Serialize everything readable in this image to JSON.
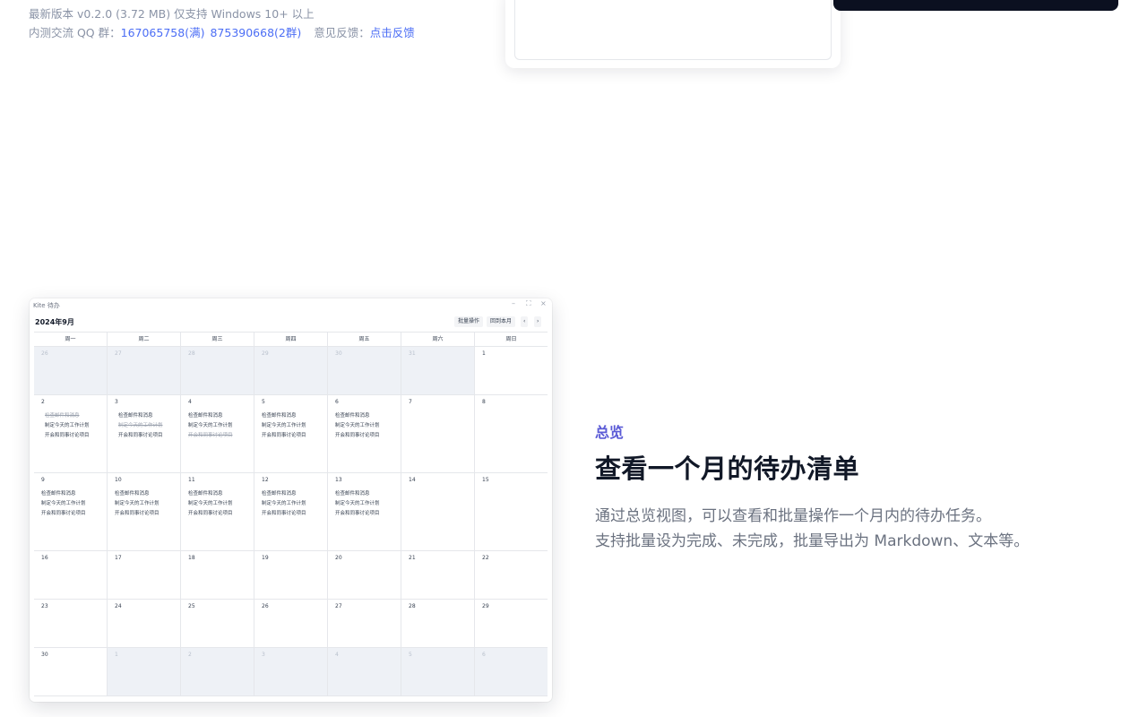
{
  "info": {
    "version_line": "最新版本 v0.2.0 (3.72 MB) 仅支持 Windows 10+ 以上",
    "qq_label": "内测交流 QQ 群：",
    "qq_group1": "167065758(满)",
    "qq_group2": "875390668(2群)",
    "feedback_label": "意见反馈：",
    "feedback_link": "点击反馈"
  },
  "colors": {
    "accent": "#5b5bd6",
    "link": "#4c6ef5",
    "task_red": "#ef4444",
    "task_orange": "#f97316",
    "task_green": "#22c55e",
    "task_blue": "#3b82f6",
    "task_purple": "#8b5cf6",
    "task_gray": "#64748b"
  },
  "window": {
    "title": "Kite 待办",
    "controls": [
      "minimize-icon",
      "maximize-icon",
      "close-icon"
    ],
    "month": "2024年9月",
    "batch_button": "批量操作",
    "today_button": "回到本月",
    "prev_icon": "chevron-left-icon",
    "next_icon": "chevron-right-icon",
    "weekdays": [
      "周一",
      "周二",
      "周三",
      "周四",
      "周五",
      "周六",
      "周日"
    ],
    "weeks": [
      [
        {
          "d": "26",
          "out": true,
          "tasks": []
        },
        {
          "d": "27",
          "out": true,
          "tasks": []
        },
        {
          "d": "28",
          "out": true,
          "tasks": []
        },
        {
          "d": "29",
          "out": true,
          "tasks": []
        },
        {
          "d": "30",
          "out": true,
          "tasks": []
        },
        {
          "d": "31",
          "out": true,
          "tasks": []
        },
        {
          "d": "1",
          "out": false,
          "tasks": []
        }
      ],
      [
        {
          "d": "2",
          "out": false,
          "tasks": [
            {
              "text": "检查邮件和消息",
              "color": "task_red",
              "done": true
            },
            {
              "text": "制定今天的工作计划",
              "color": "task_green",
              "done": false
            },
            {
              "text": "开会和同事讨论项目",
              "color": "task_blue",
              "done": false
            }
          ]
        },
        {
          "d": "3",
          "out": false,
          "tasks": [
            {
              "text": "检查邮件和消息",
              "color": "task_orange",
              "done": false
            },
            {
              "text": "制定今天的工作计划",
              "color": "task_purple",
              "done": true
            },
            {
              "text": "开会和同事讨论项目",
              "color": "task_gray",
              "done": false
            }
          ]
        },
        {
          "d": "4",
          "out": false,
          "tasks": [
            {
              "text": "检查邮件和消息",
              "done": false
            },
            {
              "text": "制定今天的工作计划",
              "done": false
            },
            {
              "text": "开会和同事讨论项目",
              "done": true
            }
          ]
        },
        {
          "d": "5",
          "out": false,
          "tasks": [
            {
              "text": "检查邮件和消息",
              "done": false
            },
            {
              "text": "制定今天的工作计划",
              "done": false
            },
            {
              "text": "开会和同事讨论项目",
              "done": false
            }
          ]
        },
        {
          "d": "6",
          "out": false,
          "tasks": [
            {
              "text": "检查邮件和消息",
              "done": false
            },
            {
              "text": "制定今天的工作计划",
              "done": false
            },
            {
              "text": "开会和同事讨论项目",
              "done": false
            }
          ]
        },
        {
          "d": "7",
          "out": false,
          "tasks": []
        },
        {
          "d": "8",
          "out": false,
          "tasks": []
        }
      ],
      [
        {
          "d": "9",
          "out": false,
          "tasks": [
            {
              "text": "检查邮件和消息",
              "done": false
            },
            {
              "text": "制定今天的工作计划",
              "done": false
            },
            {
              "text": "开会和同事讨论项目",
              "done": false
            }
          ]
        },
        {
          "d": "10",
          "out": false,
          "tasks": [
            {
              "text": "检查邮件和消息",
              "done": false
            },
            {
              "text": "制定今天的工作计划",
              "done": false
            },
            {
              "text": "开会和同事讨论项目",
              "done": false
            }
          ]
        },
        {
          "d": "11",
          "out": false,
          "tasks": [
            {
              "text": "检查邮件和消息",
              "done": false
            },
            {
              "text": "制定今天的工作计划",
              "done": false
            },
            {
              "text": "开会和同事讨论项目",
              "done": false
            }
          ]
        },
        {
          "d": "12",
          "out": false,
          "tasks": [
            {
              "text": "检查邮件和消息",
              "done": false
            },
            {
              "text": "制定今天的工作计划",
              "done": false
            },
            {
              "text": "开会和同事讨论项目",
              "done": false
            }
          ]
        },
        {
          "d": "13",
          "out": false,
          "tasks": [
            {
              "text": "检查邮件和消息",
              "done": false
            },
            {
              "text": "制定今天的工作计划",
              "done": false
            },
            {
              "text": "开会和同事讨论项目",
              "done": false
            }
          ]
        },
        {
          "d": "14",
          "out": false,
          "tasks": []
        },
        {
          "d": "15",
          "out": false,
          "tasks": []
        }
      ],
      [
        {
          "d": "16",
          "out": false,
          "tasks": []
        },
        {
          "d": "17",
          "out": false,
          "tasks": []
        },
        {
          "d": "18",
          "out": false,
          "tasks": []
        },
        {
          "d": "19",
          "out": false,
          "tasks": []
        },
        {
          "d": "20",
          "out": false,
          "tasks": []
        },
        {
          "d": "21",
          "out": false,
          "tasks": []
        },
        {
          "d": "22",
          "out": false,
          "tasks": []
        }
      ],
      [
        {
          "d": "23",
          "out": false,
          "tasks": []
        },
        {
          "d": "24",
          "out": false,
          "tasks": []
        },
        {
          "d": "25",
          "out": false,
          "tasks": []
        },
        {
          "d": "26",
          "out": false,
          "tasks": []
        },
        {
          "d": "27",
          "out": false,
          "tasks": []
        },
        {
          "d": "28",
          "out": false,
          "tasks": []
        },
        {
          "d": "29",
          "out": false,
          "tasks": []
        }
      ],
      [
        {
          "d": "30",
          "out": false,
          "tasks": []
        },
        {
          "d": "1",
          "out": true,
          "tasks": []
        },
        {
          "d": "2",
          "out": true,
          "tasks": []
        },
        {
          "d": "3",
          "out": true,
          "tasks": []
        },
        {
          "d": "4",
          "out": true,
          "tasks": []
        },
        {
          "d": "5",
          "out": true,
          "tasks": []
        },
        {
          "d": "6",
          "out": true,
          "tasks": []
        }
      ]
    ]
  },
  "feature": {
    "tag": "总览",
    "title": "查看一个月的待办清单",
    "desc_line1": "通过总览视图，可以查看和批量操作一个月内的待办任务。",
    "desc_line2": "支持批量设为完成、未完成，批量导出为 Markdown、文本等。"
  }
}
